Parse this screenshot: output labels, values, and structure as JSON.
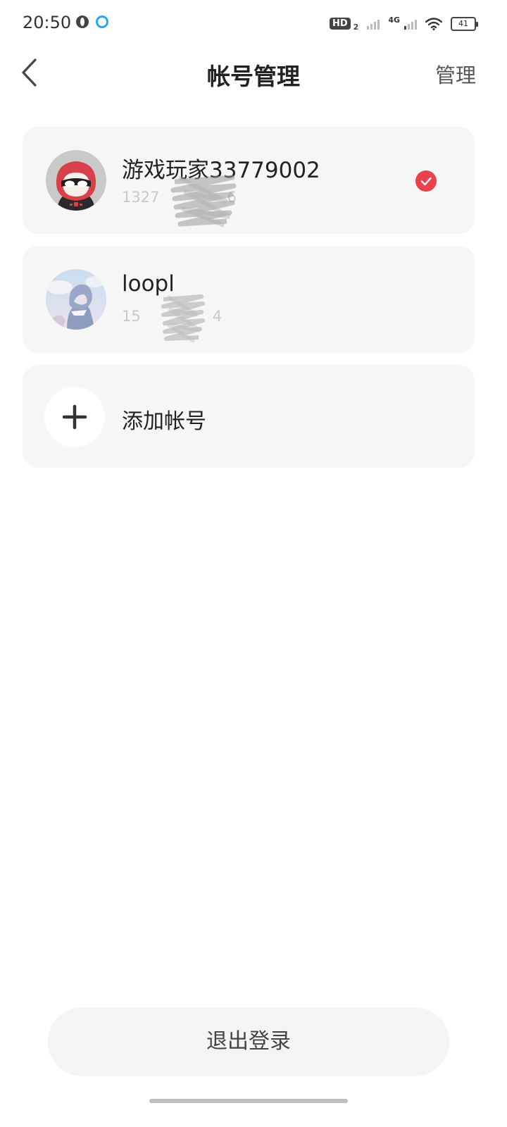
{
  "status_bar": {
    "time": "20:50",
    "app_icons": [
      "globe-icon",
      "qq-icon"
    ],
    "hd_label": "HD",
    "hd_sub": "2",
    "network_label": "4G",
    "battery_level": "41"
  },
  "header": {
    "back_icon": "chevron-left-icon",
    "title": "帐号管理",
    "manage_label": "管理"
  },
  "accounts": [
    {
      "name": "游戏玩家33779002",
      "phone_visible": "1327",
      "phone_trailing": "6",
      "avatar": "ninja-avatar",
      "selected": true
    },
    {
      "name": "loopl",
      "phone_visible": "15",
      "phone_trailing": "4",
      "avatar": "anime-avatar",
      "selected": false
    }
  ],
  "add_account": {
    "icon": "plus-icon",
    "label": "添加帐号"
  },
  "logout": {
    "label": "退出登录"
  },
  "colors": {
    "accent_red": "#e8424a",
    "card_bg": "#f6f6f6",
    "button_bg": "#f4f4f4"
  }
}
